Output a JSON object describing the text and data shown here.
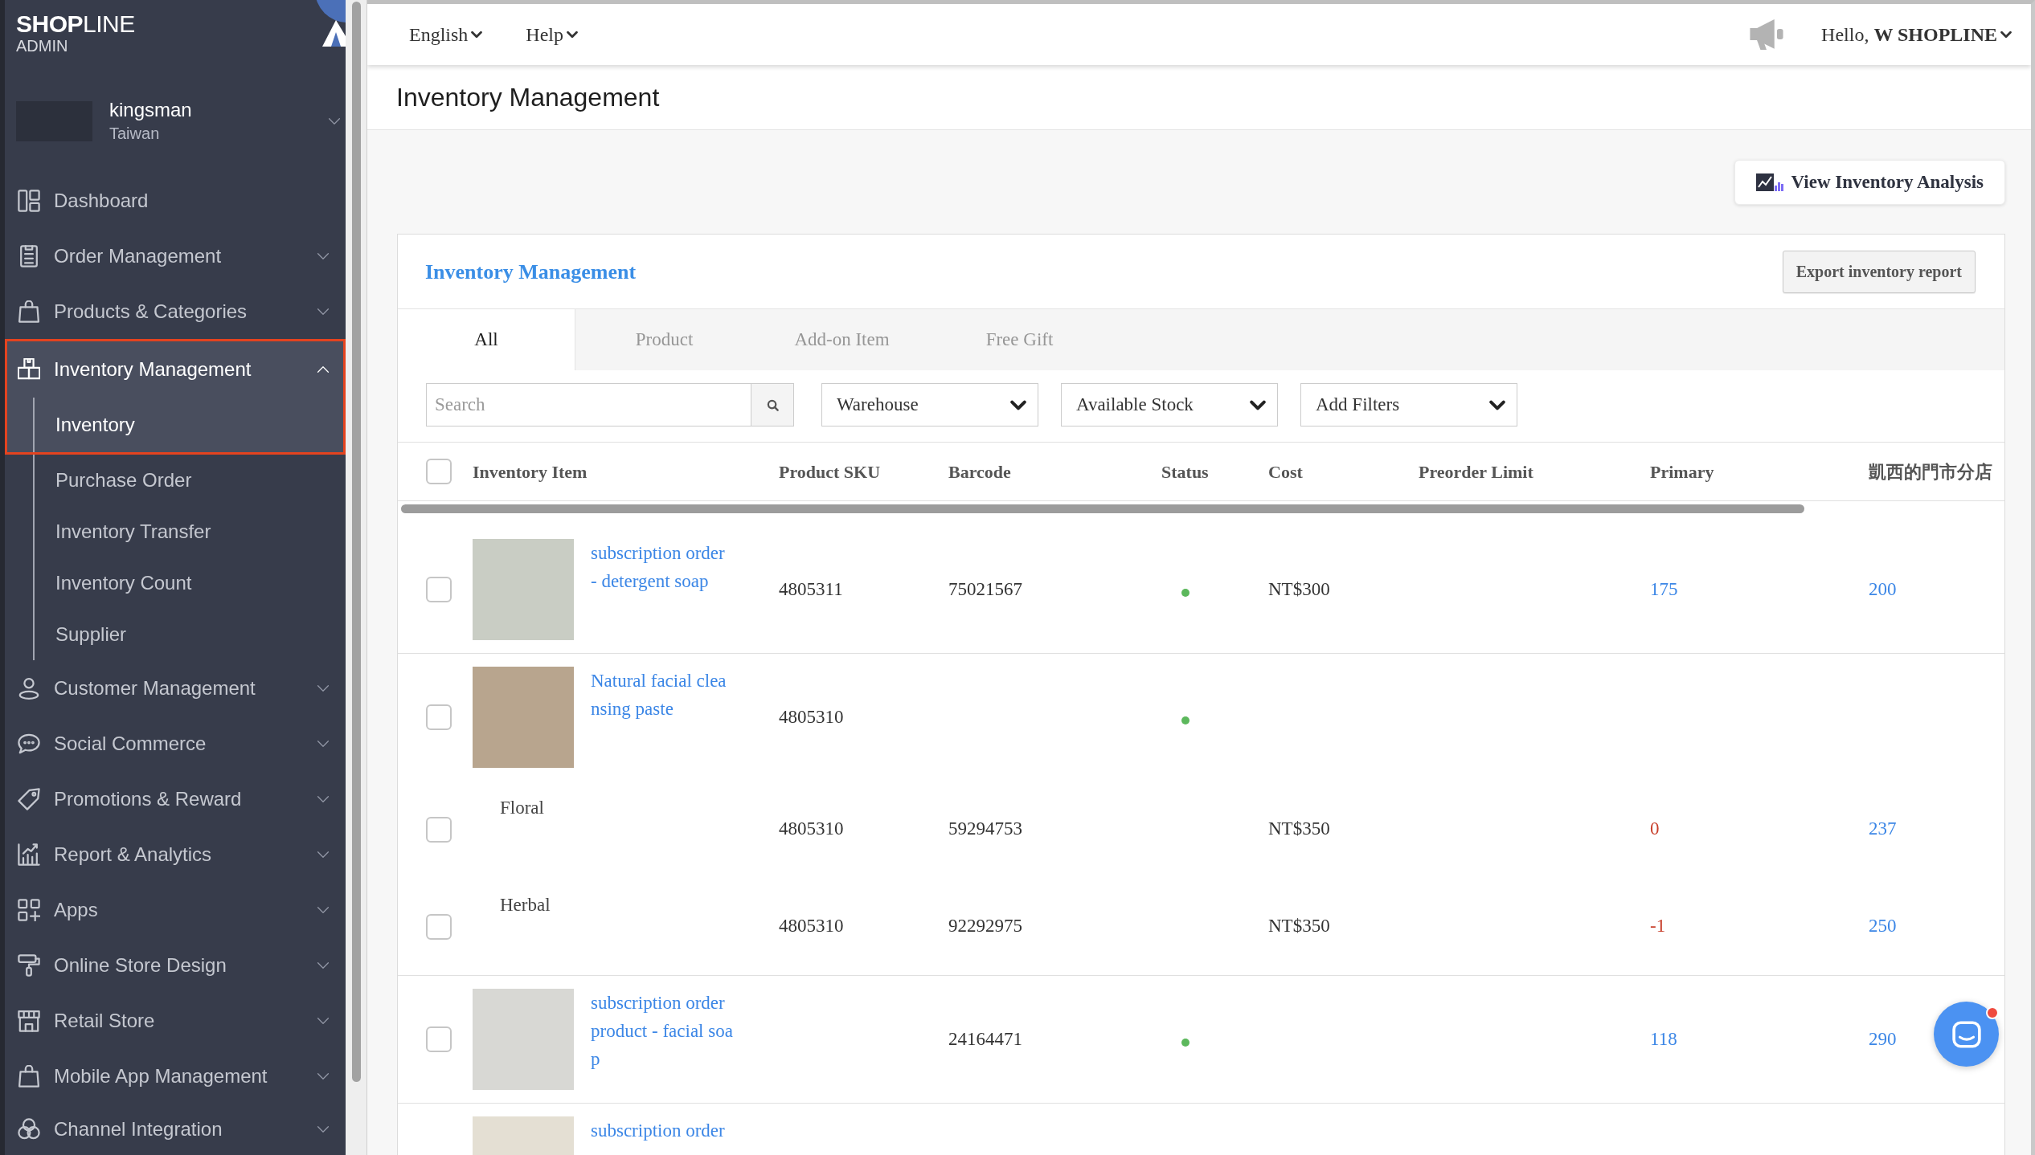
{
  "sidebar": {
    "logo": {
      "wordmark": "**SHOP**LINE",
      "subtitle": "ADMIN"
    },
    "store": {
      "name": "kingsman",
      "region": "Taiwan"
    },
    "menu": [
      {
        "label": "Dashboard",
        "kind": "link",
        "selected": false
      },
      {
        "label": "Order Management",
        "kind": "group",
        "selected": false,
        "expanded": false
      },
      {
        "label": "Products & Categories",
        "kind": "group",
        "selected": false,
        "expanded": false
      },
      {
        "label": "Inventory Management",
        "kind": "group",
        "selected": true,
        "expanded": true,
        "annotated": true,
        "children": [
          {
            "label": "Inventory",
            "selected": true
          },
          {
            "label": "Purchase Order",
            "selected": false
          },
          {
            "label": "Inventory Transfer",
            "selected": false
          },
          {
            "label": "Inventory Count",
            "selected": false
          },
          {
            "label": "Supplier",
            "selected": false
          }
        ]
      },
      {
        "label": "Customer Management",
        "kind": "group",
        "selected": false,
        "expanded": false
      },
      {
        "label": "Social Commerce",
        "kind": "group",
        "selected": false,
        "expanded": false
      },
      {
        "label": "Promotions & Reward",
        "kind": "group",
        "selected": false,
        "expanded": false
      },
      {
        "label": "Report & Analytics",
        "kind": "group",
        "selected": false,
        "expanded": false
      },
      {
        "label": "Apps",
        "kind": "group",
        "selected": false,
        "expanded": false
      },
      {
        "label": "Online Store Design",
        "kind": "group",
        "selected": false,
        "expanded": false
      },
      {
        "label": "Retail Store",
        "kind": "group",
        "selected": false,
        "expanded": false
      },
      {
        "label": "Mobile App Management",
        "kind": "group",
        "selected": false,
        "expanded": false
      },
      {
        "label": "Channel Integration",
        "kind": "group",
        "selected": false,
        "expanded": false
      }
    ]
  },
  "top_bar": {
    "menus": [
      {
        "label": "English"
      },
      {
        "label": "Help"
      }
    ],
    "user_menu": "Hello, **W SHOPLINE**"
  },
  "page": {
    "title": "Inventory Management",
    "analysis_button": "View Inventory Analysis"
  },
  "card": {
    "title": "Inventory Management",
    "export_button": "Export inventory report",
    "tabs": [
      {
        "label": "All",
        "selected": true
      },
      {
        "label": "Product",
        "selected": false
      },
      {
        "label": "Add-on Item",
        "selected": false
      },
      {
        "label": "Free Gift",
        "selected": false
      }
    ],
    "search": {
      "placeholder": "Search"
    },
    "filters": [
      {
        "label": "Warehouse"
      },
      {
        "label": "Available Stock"
      },
      {
        "label": "Add Filters"
      }
    ],
    "table": {
      "select_all_checked": false,
      "columns": [
        "Inventory Item",
        "Product SKU",
        "Barcode",
        "Status",
        "Cost",
        "Preorder Limit",
        "Primary",
        "凱西的門市分店"
      ],
      "rows": [
        {
          "checked": false,
          "name": "subscription order - detergent soap",
          "sku": "4805311",
          "barcode": "75021567",
          "status": {
            "color": "#5cb85c"
          },
          "cost": "NT$300",
          "stock": [
            {
              "text": "175",
              "low": false
            },
            {
              "text": "200",
              "low": false
            }
          ]
        },
        {
          "checked": false,
          "name": "Natural facial cleansing paste",
          "sku": "4805310",
          "status": {
            "color": "#5cb85c"
          },
          "variants": [
            {
              "label": "Floral",
              "checked": false,
              "sku": "4805310",
              "barcode": "59294753",
              "cost": "NT$350",
              "stock": [
                {
                  "text": "0",
                  "low": true
                },
                {
                  "text": "237",
                  "low": false
                }
              ]
            },
            {
              "label": "Herbal",
              "checked": false,
              "sku": "4805310",
              "barcode": "92292975",
              "cost": "NT$350",
              "stock": [
                {
                  "text": "-1",
                  "low": true
                },
                {
                  "text": "250",
                  "low": false
                }
              ]
            }
          ]
        },
        {
          "checked": false,
          "name": "subscription order product - facial soap",
          "barcode": "24164471",
          "status": {
            "color": "#5cb85c"
          },
          "stock": [
            {
              "text": "118",
              "low": false
            },
            {
              "text": "290",
              "low": false
            }
          ]
        },
        {
          "name": "subscription order"
        }
      ]
    }
  },
  "chat": {
    "unread": true
  }
}
